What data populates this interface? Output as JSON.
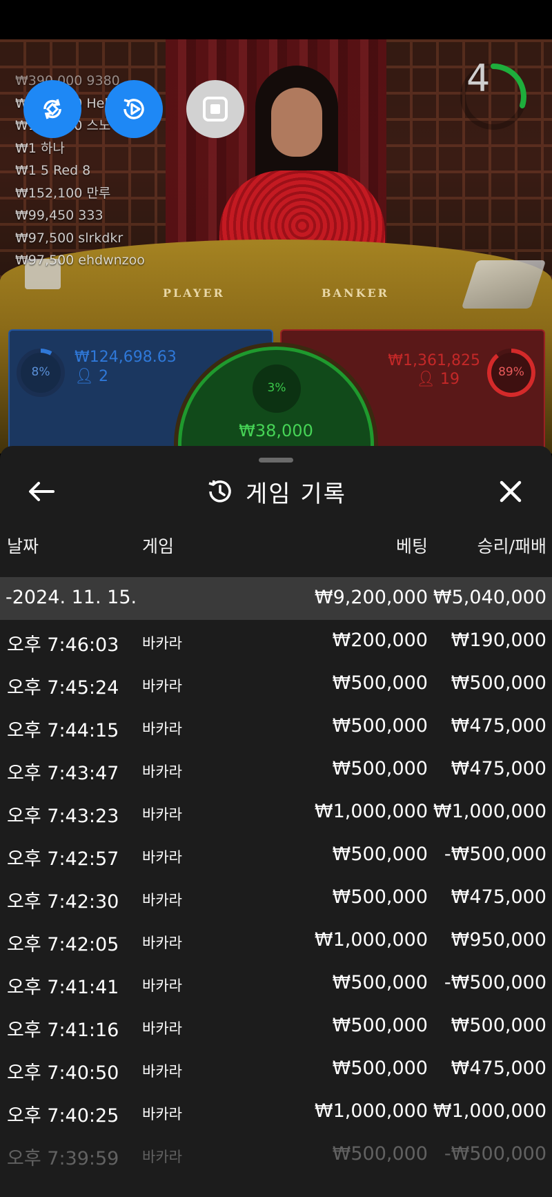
{
  "stream": {
    "timer": "4",
    "chat": [
      "₩390,000 9380",
      "₩390,000 Hello",
      "₩190,000 스노",
      "₩1 하나",
      "₩1 5 Red 8",
      "₩152,100 만루",
      "₩99,450 333",
      "₩97,500 slrkdkr",
      "₩97,500 ehdwnzoo"
    ],
    "table_labels": {
      "player": "PLAYER",
      "banker": "BANKER"
    },
    "player": {
      "percent": "8%",
      "amount": "₩124,698.63",
      "count": "2",
      "color": "#2f78d8"
    },
    "banker": {
      "percent": "89%",
      "amount": "₩1,361,825",
      "count": "19",
      "color": "#c42828"
    },
    "tie": {
      "percent": "3%",
      "amount": "₩38,000",
      "color": "#46d456"
    }
  },
  "sheet": {
    "title": "게임 기록",
    "columns": {
      "date": "날짜",
      "game": "게임",
      "bet": "베팅",
      "result": "승리/패배"
    },
    "date_group": {
      "date": "-2024. 11. 15.",
      "bet_total": "₩9,200,000",
      "result_total": "₩5,040,000"
    },
    "rows": [
      {
        "time": "오후 7:46:03",
        "game": "바카라",
        "bet": "₩200,000",
        "result": "₩190,000"
      },
      {
        "time": "오후 7:45:24",
        "game": "바카라",
        "bet": "₩500,000",
        "result": "₩500,000"
      },
      {
        "time": "오후 7:44:15",
        "game": "바카라",
        "bet": "₩500,000",
        "result": "₩475,000"
      },
      {
        "time": "오후 7:43:47",
        "game": "바카라",
        "bet": "₩500,000",
        "result": "₩475,000"
      },
      {
        "time": "오후 7:43:23",
        "game": "바카라",
        "bet": "₩1,000,000",
        "result": "₩1,000,000"
      },
      {
        "time": "오후 7:42:57",
        "game": "바카라",
        "bet": "₩500,000",
        "result": "-₩500,000"
      },
      {
        "time": "오후 7:42:30",
        "game": "바카라",
        "bet": "₩500,000",
        "result": "₩475,000"
      },
      {
        "time": "오후 7:42:05",
        "game": "바카라",
        "bet": "₩1,000,000",
        "result": "₩950,000"
      },
      {
        "time": "오후 7:41:41",
        "game": "바카라",
        "bet": "₩500,000",
        "result": "-₩500,000"
      },
      {
        "time": "오후 7:41:16",
        "game": "바카라",
        "bet": "₩500,000",
        "result": "₩500,000"
      },
      {
        "time": "오후 7:40:50",
        "game": "바카라",
        "bet": "₩500,000",
        "result": "₩475,000"
      },
      {
        "time": "오후 7:40:25",
        "game": "바카라",
        "bet": "₩1,000,000",
        "result": "₩1,000,000"
      },
      {
        "time": "오후 7:39:59",
        "game": "바카라",
        "bet": "₩500,000",
        "result": "-₩500,000"
      }
    ]
  }
}
